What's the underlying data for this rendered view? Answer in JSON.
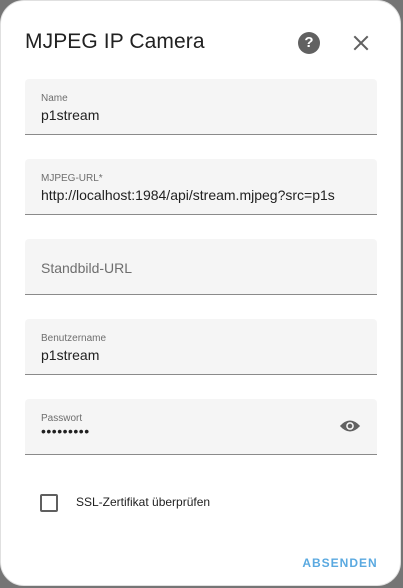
{
  "dialog": {
    "title": "MJPEG IP Camera",
    "help_icon": "help-circle-icon",
    "close_icon": "close-icon"
  },
  "fields": {
    "name": {
      "label": "Name",
      "value": "p1stream"
    },
    "mjpeg_url": {
      "label": "MJPEG-URL*",
      "value": "http://localhost:1984/api/stream.mjpeg?src=p1s"
    },
    "still_url": {
      "placeholder": "Standbild-URL"
    },
    "username": {
      "label": "Benutzername",
      "value": "p1stream"
    },
    "password": {
      "label": "Passwort",
      "value": "•••••••••",
      "toggle_icon": "eye-icon"
    }
  },
  "ssl": {
    "label": "SSL-Zertifikat überprüfen",
    "checked": false
  },
  "actions": {
    "submit_label": "ABSENDEN"
  },
  "colors": {
    "accent": "#5aa9e0",
    "field_bg": "#f5f5f5"
  }
}
